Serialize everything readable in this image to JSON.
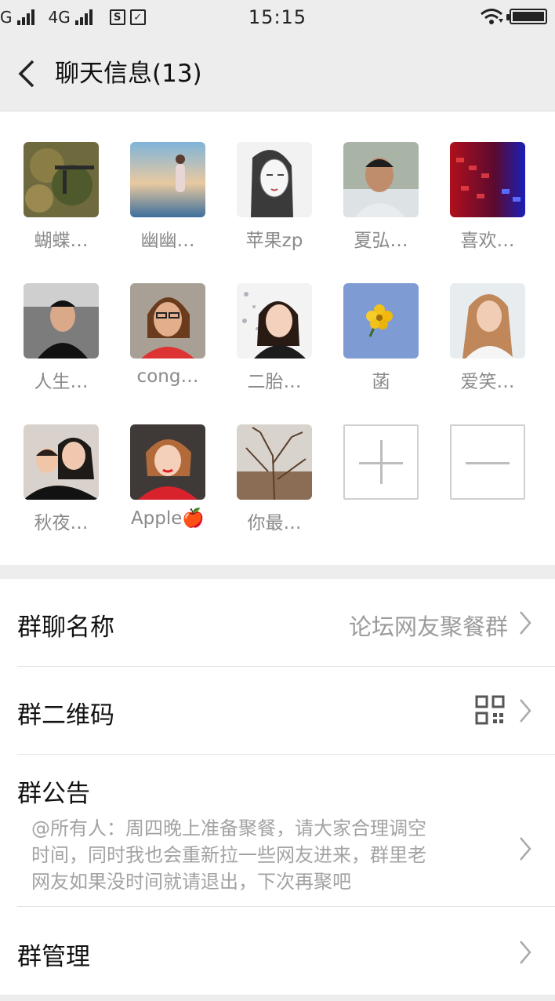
{
  "status_bar": {
    "carrier_left": "G",
    "network": "4G",
    "sim_icon": "S",
    "time": "15:15"
  },
  "header": {
    "title": "聊天信息(13)"
  },
  "members": [
    {
      "name": "蝴蝶…",
      "avatar": "camouflage-soldier"
    },
    {
      "name": "幽幽…",
      "avatar": "girl-at-beach"
    },
    {
      "name": "苹果zp",
      "avatar": "sketch-girl"
    },
    {
      "name": "夏弘…",
      "avatar": "man-portrait"
    },
    {
      "name": "喜欢…",
      "avatar": "red-blue-keyboard"
    },
    {
      "name": "人生…",
      "avatar": "man-in-car"
    },
    {
      "name": "cong…",
      "avatar": "woman-glasses"
    },
    {
      "name": "二胎…",
      "avatar": "woman-smiling"
    },
    {
      "name": "菡",
      "avatar": "yellow-flower"
    },
    {
      "name": "爱笑…",
      "avatar": "woman-smiling-side"
    },
    {
      "name": "秋夜…",
      "avatar": "mother-child"
    },
    {
      "name": "Apple🍎",
      "avatar": "woman-red-jacket"
    },
    {
      "name": "你最…",
      "avatar": "tree-branches"
    }
  ],
  "settings": {
    "group_name_label": "群聊名称",
    "group_name_value": "论坛网友聚餐群",
    "qrcode_label": "群二维码",
    "notice_label": "群公告",
    "notice_text_line1": "@所有人：周四晚上准备聚餐，请大家合理调空",
    "notice_text_line2": "时间，同时我也会重新拉一些网友进来，群里老",
    "notice_text_line3": "网友如果没时间就请退出，下次再聚吧",
    "manage_label": "群管理"
  },
  "colors": {
    "background": "#ededed",
    "card": "#ffffff",
    "secondary_text": "#9b9b9b"
  }
}
